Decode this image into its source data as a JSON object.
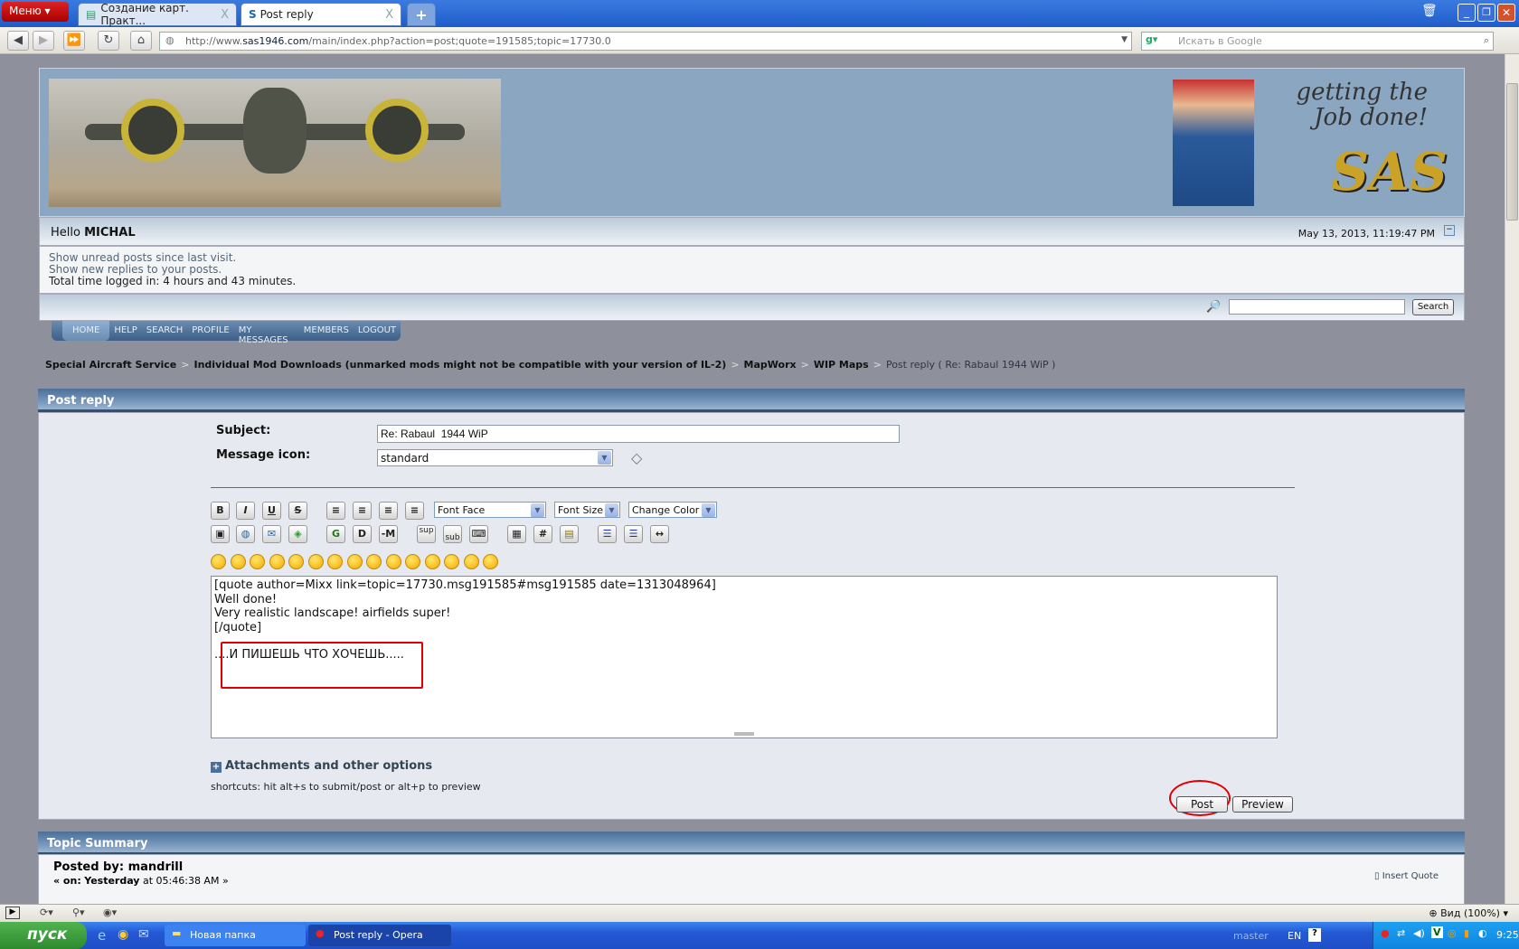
{
  "browser": {
    "menu_label": "Меню",
    "tabs": [
      {
        "label": "Создание карт. Практ..."
      },
      {
        "label": "Post reply"
      }
    ],
    "url_prefix": "http://www.",
    "url_domain": "sas1946.com",
    "url_path": "/main/index.php?action=post;quote=191585;topic=17730.0",
    "search_placeholder": "Искать в Google",
    "zoom_label": "Вид (100%)"
  },
  "header": {
    "slogan_line1": "getting the",
    "slogan_line2": "Job done!",
    "logo": "SAS"
  },
  "user": {
    "greeting": "Hello",
    "name": "MICHAL",
    "datetime": "May 13, 2013, 11:19:47 PM"
  },
  "info": {
    "unread": "Show unread posts since last visit.",
    "replies": "Show new replies to your posts.",
    "time_logged": "Total time logged in: 4 hours and 43 minutes."
  },
  "search": {
    "button": "Search",
    "value": ""
  },
  "nav": [
    "HOME",
    "HELP",
    "SEARCH",
    "PROFILE",
    "MY MESSAGES",
    "MEMBERS",
    "LOGOUT"
  ],
  "breadcrumb": [
    "Special Aircraft Service",
    "Individual Mod Downloads (unmarked mods might not be compatible with your version of IL-2)",
    "MapWorx",
    "WIP Maps",
    "Post reply ( Re: Rabaul 1944 WiP )"
  ],
  "post": {
    "title": "Post reply",
    "subject_label": "Subject:",
    "subject_value": "Re: Rabaul  1944 WiP",
    "icon_label": "Message icon:",
    "icon_value": "standard",
    "font_face": "Font Face",
    "font_size": "Font Size",
    "change_color": "Change Color",
    "toolbar1": [
      "B",
      "I",
      "U",
      "S"
    ],
    "toolbar2_text": [
      "G",
      "D",
      "-M",
      "sup",
      "sub",
      "#"
    ],
    "message_lines": [
      "[quote author=Mixx link=topic=17730.msg191585#msg191585 date=1313048964]",
      "Well done!",
      "Very realistic landscape! airfields super!",
      "[/quote]",
      "",
      "....И ПИШЕШЬ ЧТО ХОЧЕШЬ....."
    ],
    "attachments": "Attachments and other options",
    "shortcuts": "shortcuts: hit alt+s to submit/post or alt+p to preview",
    "post_button": "Post",
    "preview_button": "Preview",
    "annotation_color": "#e00000"
  },
  "summary": {
    "title": "Topic Summary",
    "posted_by": "Posted by: mandrill",
    "on_label": "« on:",
    "on_day": "Yesterday",
    "on_time": "at 05:46:38 AM »",
    "insert_quote": "Insert Quote"
  },
  "taskbar": {
    "start": "пуск",
    "tasks": [
      "Новая папка",
      "Post reply - Opera"
    ],
    "user": "master",
    "lang": "EN",
    "clock": "9:25"
  }
}
